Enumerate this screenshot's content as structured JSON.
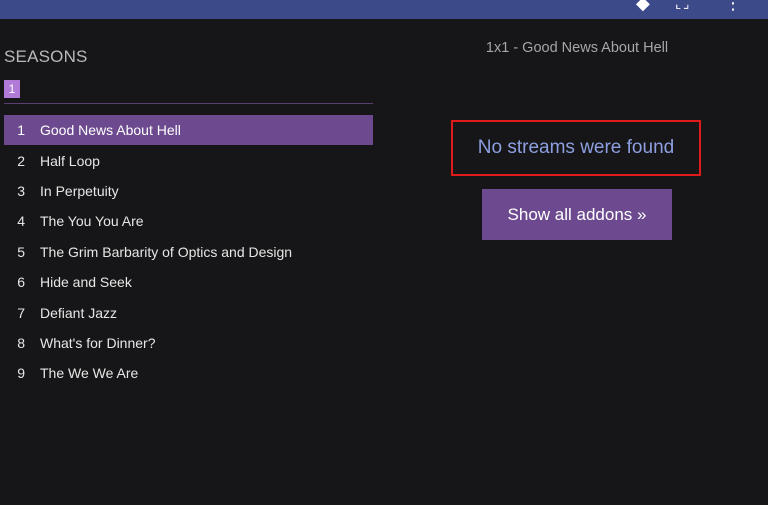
{
  "topbar": {
    "icons": [
      "share-icon",
      "fullscreen-icon",
      "more-icon"
    ]
  },
  "seasons": {
    "label": "SEASONS",
    "selected": "1"
  },
  "episodes": [
    {
      "number": "1",
      "title": "Good News About Hell",
      "selected": true
    },
    {
      "number": "2",
      "title": "Half Loop"
    },
    {
      "number": "3",
      "title": "In Perpetuity"
    },
    {
      "number": "4",
      "title": "The You You Are"
    },
    {
      "number": "5",
      "title": "The Grim Barbarity of Optics and Design"
    },
    {
      "number": "6",
      "title": "Hide and Seek"
    },
    {
      "number": "7",
      "title": "Defiant Jazz"
    },
    {
      "number": "8",
      "title": "What's for Dinner?"
    },
    {
      "number": "9",
      "title": "The We We Are"
    }
  ],
  "streams": {
    "heading": "1x1 - Good News About Hell",
    "empty_message": "No streams were found",
    "show_all_label": "Show all addons »"
  },
  "colors": {
    "topbar": "#3d4a8a",
    "accent": "#6d4a8f",
    "chip": "#b07ad6",
    "highlight_border": "#e01b1b",
    "message": "#8d9fe0"
  }
}
